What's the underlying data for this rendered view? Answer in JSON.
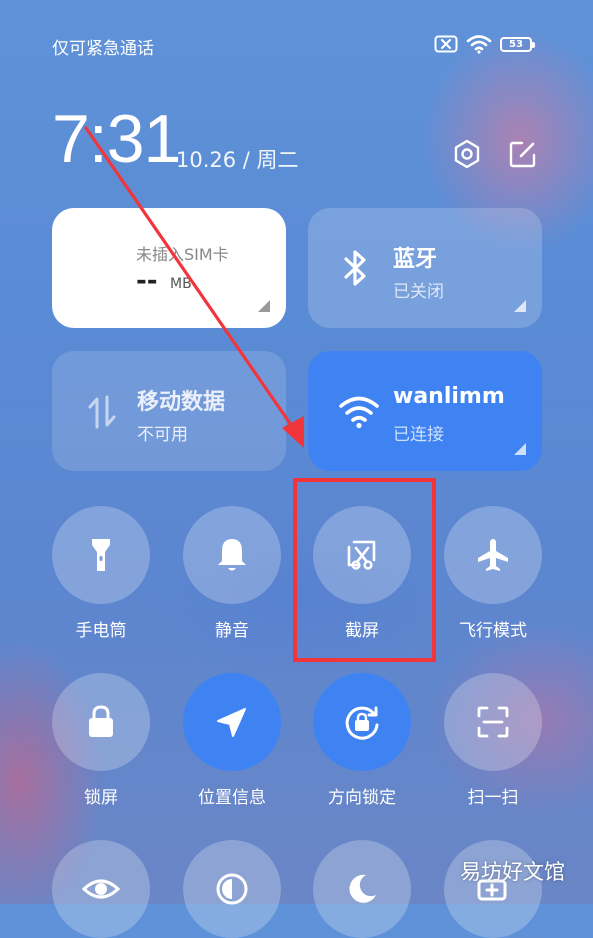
{
  "status_bar": {
    "carrier": "仅可紧急通话",
    "battery": "53"
  },
  "header": {
    "time": "7:31",
    "date": "10.26 / 周二",
    "icons": [
      "settings-icon",
      "edit-icon"
    ]
  },
  "tiles": {
    "sim": {
      "title": "未插入SIM卡",
      "value": "--",
      "unit": "MB"
    },
    "bluetooth": {
      "title": "蓝牙",
      "status": "已关闭"
    },
    "mobile_data": {
      "title": "移动数据",
      "status": "不可用"
    },
    "wifi": {
      "title": "wanlimm",
      "status": "已连接",
      "color": "#3f83f3"
    }
  },
  "toggles": [
    {
      "label": "手电筒",
      "icon": "flashlight-icon",
      "on": false
    },
    {
      "label": "静音",
      "icon": "bell-icon",
      "on": false
    },
    {
      "label": "截屏",
      "icon": "screenshot-icon",
      "on": false
    },
    {
      "label": "飞行模式",
      "icon": "airplane-icon",
      "on": false
    },
    {
      "label": "锁屏",
      "icon": "lock-icon",
      "on": false
    },
    {
      "label": "位置信息",
      "icon": "location-icon",
      "on": true
    },
    {
      "label": "方向锁定",
      "icon": "rotation-lock-icon",
      "on": true
    },
    {
      "label": "扫一扫",
      "icon": "scan-icon",
      "on": false
    }
  ],
  "annotation": {
    "color": "#f2353a"
  },
  "watermark": "易坊好文馆"
}
